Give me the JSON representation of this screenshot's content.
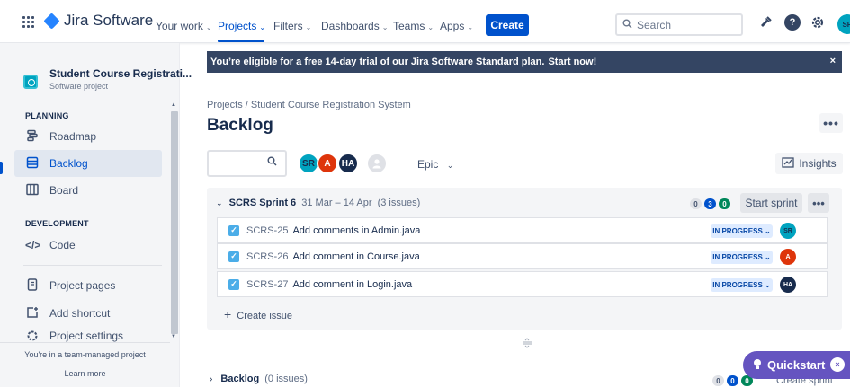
{
  "topnav": {
    "app_name": "Jira Software",
    "items": [
      {
        "label": "Your work",
        "chev": "⌄"
      },
      {
        "label": "Projects",
        "chev": "⌄"
      },
      {
        "label": "Filters",
        "chev": "⌄"
      },
      {
        "label": "Dashboards",
        "chev": "⌄"
      },
      {
        "label": "Teams",
        "chev": "⌄"
      },
      {
        "label": "Apps",
        "chev": "⌄"
      }
    ],
    "active_item": "Projects",
    "create_label": "Create",
    "search_placeholder": "Search",
    "help_glyph": "?",
    "user_initials": "SR",
    "icons": [
      "app-switcher-icon",
      "jira-logo-icon",
      "search-icon",
      "notifications-icon",
      "help-icon",
      "settings-icon"
    ],
    "accent_color": "#0052cc"
  },
  "sidebar": {
    "project_name": "Student Course Registrati...",
    "project_type": "Software project",
    "planning_title": "PLANNING",
    "planning_items": [
      {
        "label": "Roadmap",
        "icon": "roadmap-icon"
      },
      {
        "label": "Backlog",
        "icon": "backlog-icon",
        "selected": true
      },
      {
        "label": "Board",
        "icon": "board-icon"
      }
    ],
    "development_title": "DEVELOPMENT",
    "development_items": [
      {
        "label": "Code",
        "icon": "code-icon"
      }
    ],
    "extra_items": [
      {
        "label": "Project pages",
        "icon": "pages-icon"
      },
      {
        "label": "Add shortcut",
        "icon": "add-shortcut-icon"
      },
      {
        "label": "Project settings",
        "icon": "settings-icon"
      }
    ],
    "footer_line": "You're in a team-managed project",
    "footer_link": "Learn more"
  },
  "banner": {
    "text": "You’re eligible for a free 14-day trial of our Jira Software Standard plan.",
    "link": "Start now!",
    "close": "×"
  },
  "page": {
    "breadcrumb": "Projects  /  Student Course Registration System",
    "title": "Backlog",
    "more": "•••",
    "epic_label": "Epic",
    "insights_label": "Insights",
    "avatars": [
      {
        "initials": "SR",
        "color": "#00a3bf"
      },
      {
        "initials": "A",
        "color": "#de350b"
      },
      {
        "initials": "HA",
        "color": "#172b4d"
      }
    ]
  },
  "sprint": {
    "name": "SCRS Sprint 6",
    "dates": "31 Mar – 14 Apr",
    "issue_count": "(3 issues)",
    "counts": [
      {
        "value": "0",
        "bg": "#dfe1e6",
        "fg": "#42526e"
      },
      {
        "value": "3",
        "bg": "#0052cc",
        "fg": "#ffffff"
      },
      {
        "value": "0",
        "bg": "#00875a",
        "fg": "#ffffff"
      }
    ],
    "start_label": "Start sprint",
    "more": "•••",
    "issues": [
      {
        "key": "SCRS-25",
        "summary": "Add comments in Admin.java",
        "status": "IN PROGRESS ⌄",
        "assignee": "SR",
        "assignee_color": "#00a3bf"
      },
      {
        "key": "SCRS-26",
        "summary": "Add comment in Course.java",
        "status": "IN PROGRESS ⌄",
        "assignee": "A",
        "assignee_color": "#de350b"
      },
      {
        "key": "SCRS-27",
        "summary": "Add comment in Login.java",
        "status": "IN PROGRESS ⌄",
        "assignee": "HA",
        "assignee_color": "#172b4d"
      }
    ],
    "create_issue": "Create issue"
  },
  "backlog": {
    "name": "Backlog",
    "issue_count": "(0 issues)",
    "counts": [
      {
        "value": "0",
        "bg": "#dfe1e6",
        "fg": "#42526e"
      },
      {
        "value": "0",
        "bg": "#0052cc",
        "fg": "#ffffff"
      },
      {
        "value": "0",
        "bg": "#00875a",
        "fg": "#ffffff"
      }
    ],
    "create_sprint": "Create sprint"
  },
  "quickstart": {
    "label": "Quickstart",
    "close": "×",
    "color": "#6554c0"
  }
}
